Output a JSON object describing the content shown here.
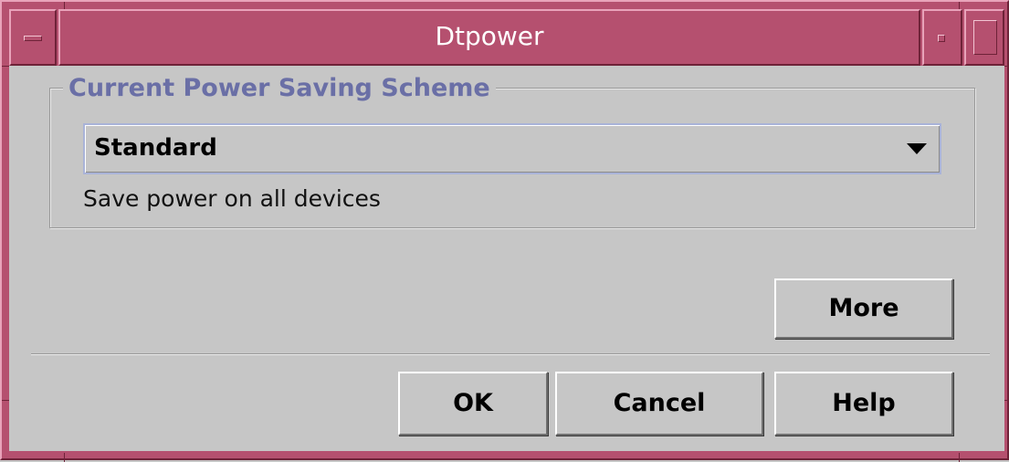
{
  "window": {
    "title": "Dtpower",
    "window_menu_icon": "window-menu-icon",
    "minimize_icon": "minimize-icon",
    "maximize_icon": "maximize-icon"
  },
  "scheme_group": {
    "title": "Current Power Saving Scheme",
    "selected": "Standard",
    "dropdown_icon": "chevron-down-icon",
    "description": "Save power on all devices"
  },
  "buttons": {
    "more": "More",
    "ok": "OK",
    "cancel": "Cancel",
    "help": "Help"
  },
  "colors": {
    "frame": "#b5506f",
    "dialog_bg": "#c6c6c6",
    "group_title": "#6a6fa6"
  }
}
